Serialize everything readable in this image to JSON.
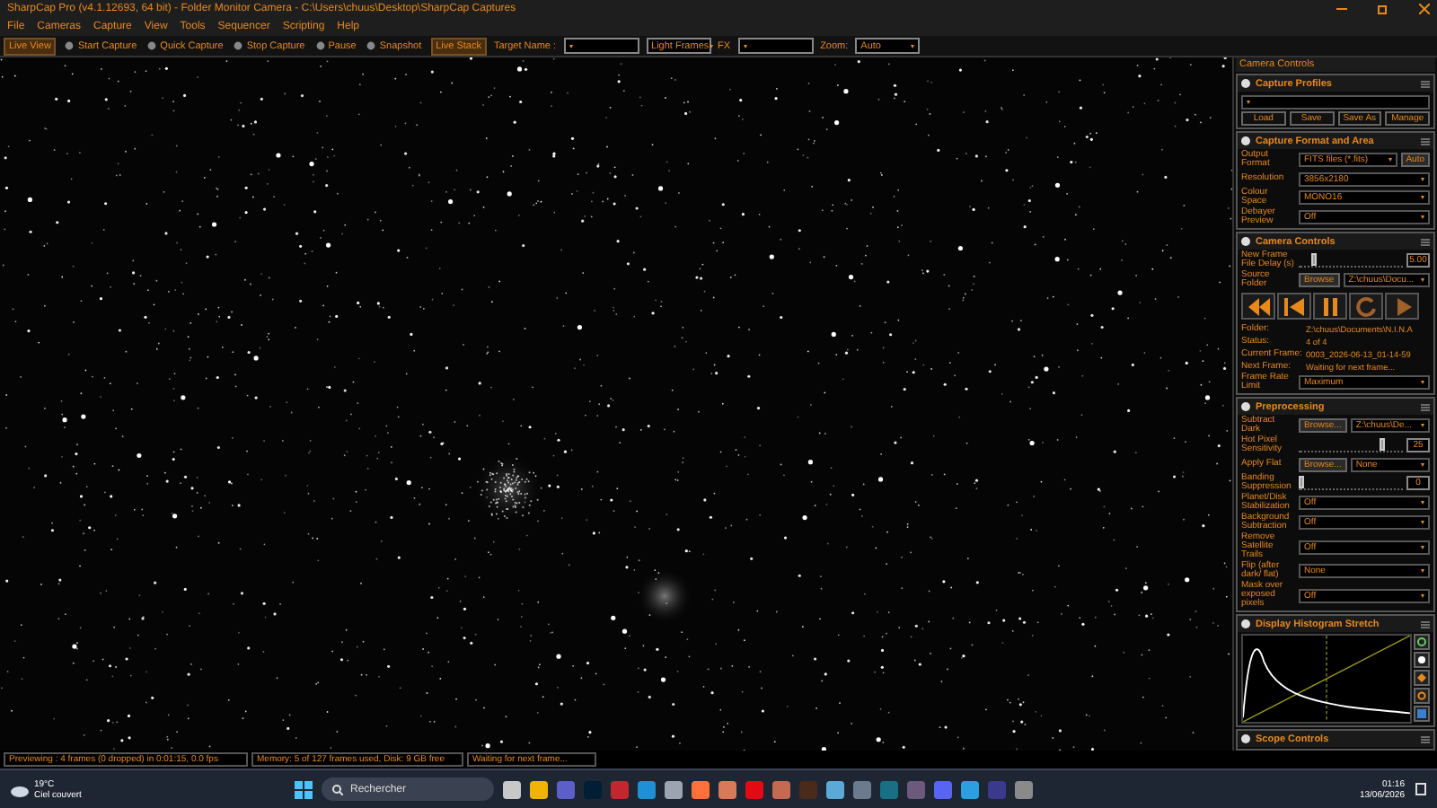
{
  "window": {
    "title": "SharpCap Pro (v4.1.12693, 64 bit) - Folder Monitor Camera - C:\\Users\\chuus\\Desktop\\SharpCap Captures"
  },
  "menu": [
    "File",
    "Cameras",
    "Capture",
    "View",
    "Tools",
    "Sequencer",
    "Scripting",
    "Help"
  ],
  "toolbar": [
    {
      "kind": "toggle",
      "label": "Live View",
      "selected": true
    },
    {
      "kind": "action",
      "label": "Start Capture"
    },
    {
      "kind": "action",
      "label": "Quick Capture"
    },
    {
      "kind": "action",
      "label": "Stop Capture"
    },
    {
      "kind": "action",
      "label": "Pause"
    },
    {
      "kind": "action",
      "label": "Snapshot"
    },
    {
      "kind": "toggle",
      "label": "Live Stack",
      "selected": true
    },
    {
      "kind": "label",
      "label": "Target Name :"
    },
    {
      "kind": "select"
    },
    {
      "kind": "select",
      "value": "Light Frames"
    },
    {
      "kind": "label",
      "label": "FX"
    },
    {
      "kind": "select"
    },
    {
      "kind": "label",
      "label": "Zoom:"
    },
    {
      "kind": "select",
      "value": "Auto"
    }
  ],
  "panel": {
    "title": "Camera Controls",
    "sections": [
      {
        "title": "Capture Profiles",
        "rows": [
          {
            "kind": "select"
          },
          {
            "kind": "buttons",
            "labels": [
              "Load",
              "Save",
              "Save As",
              "Manage"
            ]
          }
        ]
      },
      {
        "title": "Capture Format and Area",
        "rows": [
          {
            "kind": "select",
            "label": "Output Format",
            "value": "FITS files (*.fits)",
            "button": "Auto"
          },
          {
            "kind": "select",
            "label": "Resolution",
            "value": "3856x2180"
          },
          {
            "kind": "select",
            "label": "Colour Space",
            "value": "MONO16"
          },
          {
            "kind": "select",
            "label": "Debayer Preview",
            "value": "Off"
          }
        ]
      },
      {
        "title": "Camera Controls",
        "rows": [
          {
            "kind": "slider",
            "label": "New Frame File Delay (s)",
            "level": 0.12,
            "reading": "5.00"
          },
          {
            "kind": "browse",
            "label": "Source Folder",
            "button": "Browse",
            "value": "Z:\\chuus\\Docu..."
          },
          {
            "kind": "media"
          },
          {
            "kind": "info",
            "label": "Folder:",
            "value": "Z:\\chuus\\Documents\\N.I.N.A"
          },
          {
            "kind": "info",
            "label": "Status:",
            "value": "4 of 4"
          },
          {
            "kind": "info",
            "label": "Current Frame:",
            "value": "0003_2026-06-13_01-14-59"
          },
          {
            "kind": "info",
            "label": "Next Frame:",
            "value": "Waiting for next frame..."
          },
          {
            "kind": "select",
            "label": "Frame Rate Limit",
            "value": "Maximum"
          }
        ]
      },
      {
        "title": "Preprocessing",
        "rows": [
          {
            "kind": "browse",
            "label": "Subtract Dark",
            "button": "Browse...",
            "value": "Z:\\chuus\\De..."
          },
          {
            "kind": "slider",
            "label": "Hot Pixel Sensitivity",
            "level": 0.82,
            "reading": "25"
          },
          {
            "kind": "browse",
            "label": "Apply Flat",
            "button": "Browse...",
            "value": "None"
          },
          {
            "kind": "slider",
            "label": "Banding Suppression",
            "level": 0,
            "reading": "0"
          },
          {
            "kind": "select",
            "label": "Planet/Disk Stabilization",
            "value": "Off"
          },
          {
            "kind": "select",
            "label": "Background Subtraction",
            "value": "Off"
          },
          {
            "kind": "select",
            "label": "Remove Satellite Trails",
            "value": "Off"
          },
          {
            "kind": "select",
            "label": "Flip (after dark/ flat)",
            "value": "None"
          },
          {
            "kind": "select",
            "label": "Mask over exposed pixels",
            "value": "Off"
          }
        ]
      },
      {
        "title": "Display Histogram Stretch",
        "rows": [
          {
            "kind": "histogram"
          }
        ]
      },
      {
        "title": "Scope Controls"
      }
    ]
  },
  "status_bar": [
    "Previewing : 4 frames (0 dropped) in 0:01:15, 0.0 fps",
    "Memory: 5 of 127 frames used, Disk: 9 GB free",
    "Waiting for next frame..."
  ],
  "taskbar": {
    "temperature": "19°C",
    "weather": "Ciel couvert",
    "search": {
      "placeholder": "Rechercher"
    },
    "apps": [
      {
        "color": "#c8c8c8"
      },
      {
        "color": "#f0b400"
      },
      {
        "color": "#5b5fc7"
      },
      {
        "color": "#001e36"
      },
      {
        "color": "#c4262e"
      },
      {
        "color": "#1e90d6"
      },
      {
        "color": "#9aa5b1"
      },
      {
        "color": "#ff7139"
      },
      {
        "color": "#d87a5a"
      },
      {
        "color": "#e50914"
      },
      {
        "color": "#c46a50"
      },
      {
        "color": "#4a2a1a"
      },
      {
        "color": "#5aa9d6"
      },
      {
        "color": "#6b7a8c"
      },
      {
        "color": "#1b6f85"
      },
      {
        "color": "#6b5a7c"
      },
      {
        "color": "#5865f2"
      },
      {
        "color": "#2aa0e0"
      },
      {
        "color": "#3a3a8c"
      },
      {
        "color": "#8a8a8a"
      }
    ],
    "time": "01:16",
    "date": "13/06/2026"
  }
}
